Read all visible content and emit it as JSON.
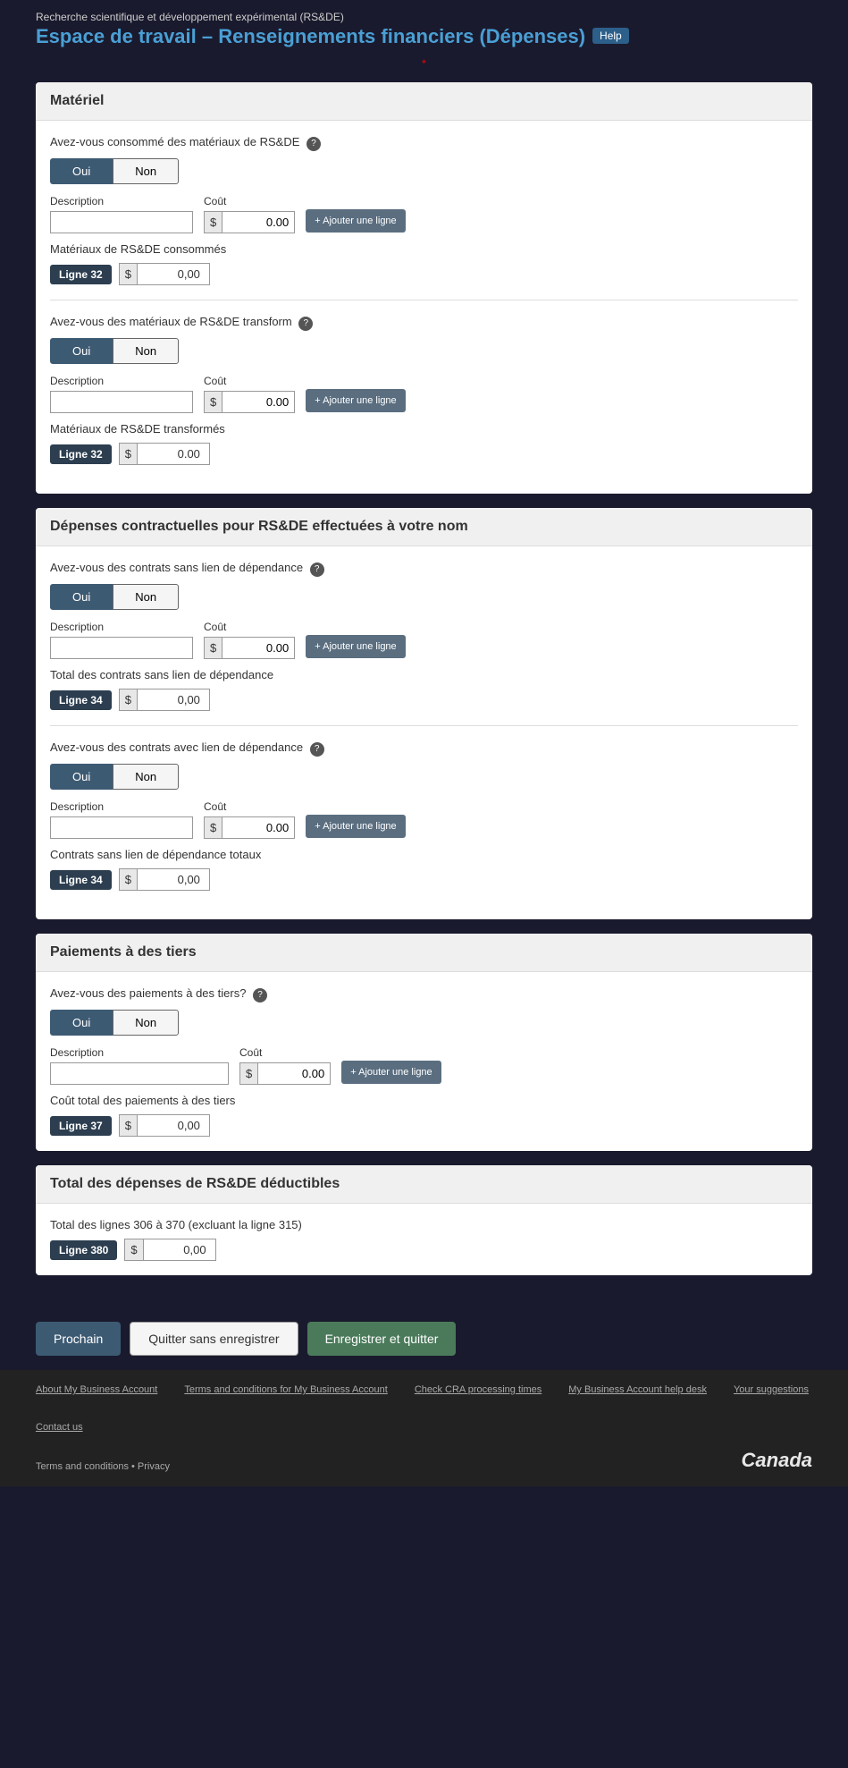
{
  "header": {
    "subtitle": "Recherche scientifique et développement expérimental (RS&DE)",
    "title": "Espace de travail – Renseignements financiers (Dépenses)",
    "help_label": "Help"
  },
  "required_note": "*",
  "sections": {
    "materiel": {
      "title": "Matériel",
      "subsections": [
        {
          "id": "consommes",
          "question": "Avez-vous consommé des matériaux de RS&DE",
          "has_help": true,
          "oui_label": "Oui",
          "non_label": "Non",
          "active": "oui",
          "desc_label": "Description",
          "cout_label": "Coût",
          "desc_value": "",
          "cout_value": "0.00",
          "add_line_label": "+ Ajouter\nune ligne",
          "total_label": "Matériaux de RS&DE consommés",
          "line_badge": "Ligne 32",
          "total_value": "0,00"
        },
        {
          "id": "transformes",
          "question": "Avez-vous des matériaux de RS&DE transform",
          "has_help": true,
          "oui_label": "Oui",
          "non_label": "Non",
          "active": "oui",
          "desc_label": "Description",
          "cout_label": "Coût",
          "desc_value": "",
          "cout_value": "0.00",
          "add_line_label": "+ Ajouter\nune ligne",
          "total_label": "Matériaux de RS&DE transformés",
          "line_badge": "Ligne 32",
          "total_value": "0.00"
        }
      ]
    },
    "contractuelles": {
      "title": "Dépenses contractuelles pour RS&DE effectuées à votre nom",
      "subsections": [
        {
          "id": "sans-lien",
          "question": "Avez-vous des contrats sans lien de dépendance",
          "has_help": true,
          "oui_label": "Oui",
          "non_label": "Non",
          "active": "oui",
          "desc_label": "Description",
          "cout_label": "Coût",
          "desc_value": "",
          "cout_value": "0.00",
          "add_line_label": "+ Ajouter\nune ligne",
          "total_label": "Total des contrats sans lien de dépendance",
          "line_badge": "Ligne 34",
          "total_value": "0,00"
        },
        {
          "id": "avec-lien",
          "question": "Avez-vous des contrats avec lien de dépendance",
          "has_help": true,
          "oui_label": "Oui",
          "non_label": "Non",
          "active": "oui",
          "desc_label": "Description",
          "cout_label": "Coût",
          "desc_value": "",
          "cout_value": "0.00",
          "add_line_label": "+ Ajouter\nune ligne",
          "total_label": "Contrats sans lien de dépendance totaux",
          "line_badge": "Ligne 34",
          "total_value": "0,00"
        }
      ]
    },
    "paiements": {
      "title": "Paiements à des tiers",
      "question": "Avez-vous des paiements à des tiers?",
      "has_help": true,
      "oui_label": "Oui",
      "non_label": "Non",
      "active": "oui",
      "desc_label": "Description",
      "cout_label": "Coût",
      "desc_value": "",
      "cout_value": "0.00",
      "add_line_label": "+ Ajouter\nune ligne",
      "total_label": "Coût total des paiements à des tiers",
      "line_badge": "Ligne 37",
      "total_value": "0,00"
    },
    "total": {
      "title": "Total des dépenses de RS&DE déductibles",
      "total_label": "Total des lignes 306 à 370 (excluant la ligne 315)",
      "line_badge": "Ligne 380",
      "total_value": "0,00"
    }
  },
  "buttons": {
    "prochain": "Prochain",
    "quitter": "Quitter sans enregistrer",
    "enregistrer": "Enregistrer et quitter"
  },
  "footer": {
    "links": [
      "About My Business Account",
      "Terms and conditions for My Business Account",
      "Check CRA processing times",
      "My Business Account help desk",
      "Your suggestions",
      "Contact us"
    ],
    "legal": "Terms and conditions • Privacy",
    "canada_logo": "Canada"
  }
}
